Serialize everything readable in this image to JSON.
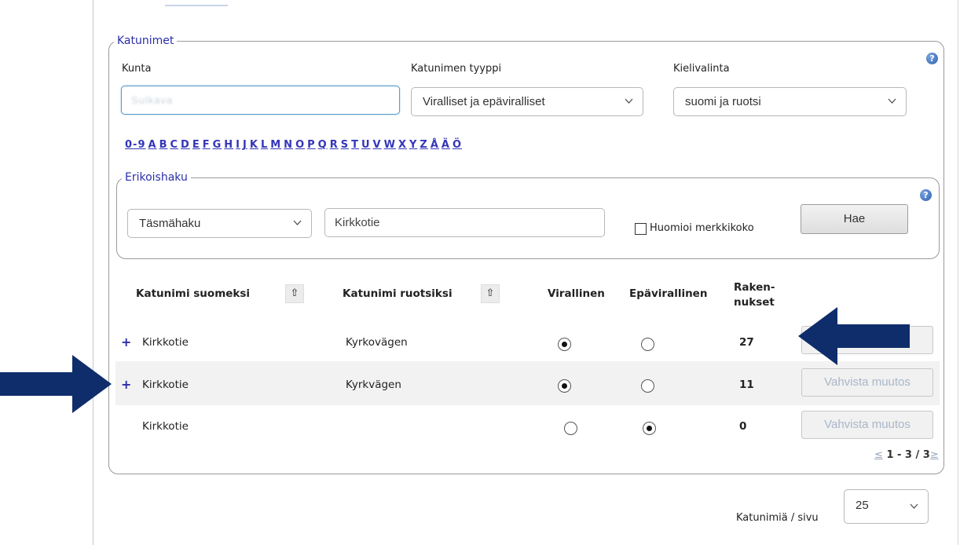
{
  "fieldsets": {
    "katunimet_legend": "Katunimet",
    "erikoishaku_legend": "Erikoishaku"
  },
  "filters": {
    "kunta_label": "Kunta",
    "kunta_value": "Sulkava",
    "tyyppi_label": "Katunimen tyyppi",
    "tyyppi_value": "Viralliset ja epäviralliset",
    "kieli_label": "Kielivalinta",
    "kieli_value": "suomi ja ruotsi"
  },
  "alphabet": [
    "0-9",
    "A",
    "B",
    "C",
    "D",
    "E",
    "F",
    "G",
    "H",
    "I",
    "J",
    "K",
    "L",
    "M",
    "N",
    "O",
    "P",
    "Q",
    "R",
    "S",
    "T",
    "U",
    "V",
    "W",
    "X",
    "Y",
    "Z",
    "Å",
    "Ä",
    "Ö"
  ],
  "special_search": {
    "mode_value": "Täsmähaku",
    "query_value": "Kirkkotie",
    "case_label": "Huomioi merkkikoko",
    "search_button": "Hae"
  },
  "table": {
    "headers": {
      "fi": "Katunimi suomeksi",
      "sv": "Katunimi ruotsiksi",
      "official": "Virallinen",
      "unofficial": "Epävirallinen",
      "buildings_line1": "Raken-",
      "buildings_line2": "nukset"
    },
    "rows": [
      {
        "fi": "Kirkkotie",
        "sv": "Kyrkovägen",
        "buildings": "27",
        "official": true,
        "expandable": true,
        "button": "Vahvista muutos"
      },
      {
        "fi": "Kirkkotie",
        "sv": "Kyrkvägen",
        "buildings": "11",
        "official": true,
        "expandable": true,
        "button": "Vahvista muutos"
      },
      {
        "fi": "Kirkkotie",
        "sv": "",
        "buildings": "0",
        "official": false,
        "expandable": false,
        "button": "Vahvista muutos"
      }
    ]
  },
  "pagination": {
    "prev": "≤",
    "range": "1 - 3 / 3",
    "next": "≥"
  },
  "per_page": {
    "label": "Katunimiä / sivu",
    "value": "25"
  },
  "colors": {
    "accent": "#2b2ea8",
    "arrow": "#0f2d6b"
  },
  "icons": [
    "help-icon",
    "chevron-down-icon",
    "sort-up-icon",
    "plus-icon",
    "arrow-left-icon",
    "arrow-right-icon"
  ]
}
